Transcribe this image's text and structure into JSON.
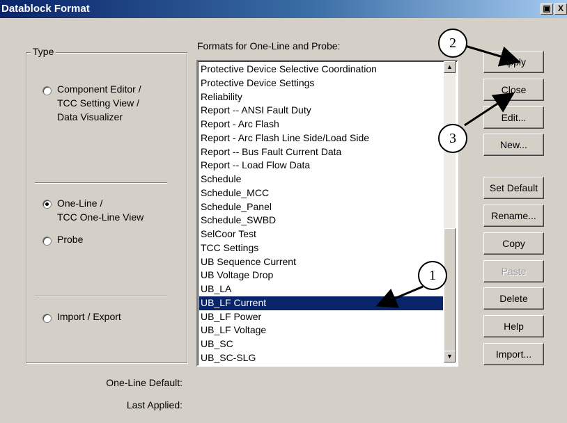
{
  "window": {
    "title": "Datablock Format",
    "restore_glyph": "▣",
    "close_glyph": "X"
  },
  "type_group": {
    "label": "Type",
    "options": [
      {
        "lines": [
          "Component Editor /",
          "TCC Setting View /",
          "Data Visualizer"
        ],
        "selected": false
      },
      {
        "lines": [
          "One-Line /",
          "TCC One-Line View"
        ],
        "selected": true
      },
      {
        "lines": [
          "Probe"
        ],
        "selected": false
      },
      {
        "lines": [
          "Import / Export"
        ],
        "selected": false
      }
    ]
  },
  "list": {
    "label": "Formats for One-Line and Probe:",
    "items": [
      "Protective Device Selective Coordination",
      "Protective Device Settings",
      "Reliability",
      "Report -- ANSI Fault Duty",
      "Report - Arc Flash",
      "Report - Arc Flash Line Side/Load Side",
      "Report -- Bus Fault Current Data",
      "Report -- Load Flow Data",
      "Schedule",
      "Schedule_MCC",
      "Schedule_Panel",
      "Schedule_SWBD",
      "SelCoor Test",
      "TCC Settings",
      "UB Sequence Current",
      "UB Voltage Drop",
      "UB_LA",
      "UB_LF Current",
      "UB_LF Power",
      "UB_LF Voltage",
      "UB_SC",
      "UB_SC-SLG"
    ],
    "selected_index": 17
  },
  "buttons": {
    "apply": "Apply",
    "close": "Close",
    "edit": "Edit...",
    "new": "New...",
    "set_default": "Set Default",
    "rename": "Rename...",
    "copy": "Copy",
    "paste": "Paste",
    "delete": "Delete",
    "help": "Help",
    "import": "Import..."
  },
  "footer": {
    "one_line_default": "One-Line Default:",
    "last_applied": "Last Applied:"
  },
  "callouts": {
    "c1": "1",
    "c2": "2",
    "c3": "3"
  }
}
